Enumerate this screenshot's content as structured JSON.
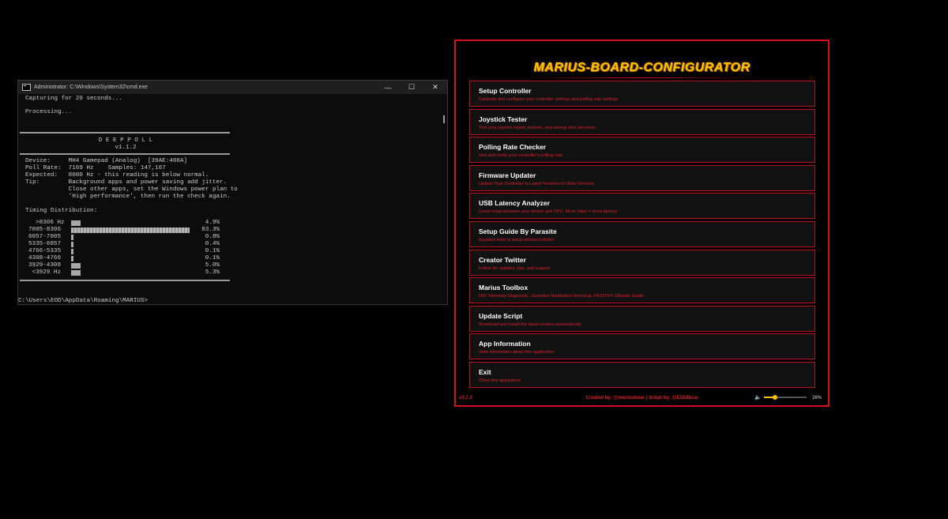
{
  "cmd": {
    "title": "Administrator: C:\\Windows\\System32\\cmd.exe",
    "controls": {
      "minimize": "—",
      "maximize": "☐",
      "close": "✕"
    },
    "capturing": "Capturing for 20 seconds...",
    "processing": "Processing...",
    "banner_title": "D E E P P O L L",
    "banner_version": "v1.1.2",
    "info": [
      "Device:     MH4 Gamepad (Analog)  [39AE:400A]",
      "Poll Rate:  7169 Hz    Samples: 147,167",
      "Expected:   8000 Hz - this reading is below normal.",
      "Tip:        Background apps and power saving add jitter.",
      "            Close other apps, set the Windows power plan to",
      "            'High performance', then run the check again."
    ],
    "timing_heading": "Timing Distribution:",
    "distribution": [
      {
        "range": "  >8306 Hz",
        "percent": "4.9%",
        "value": 4.9
      },
      {
        "range": "7005-8306",
        "percent": "83.3%",
        "value": 83.3
      },
      {
        "range": "6057-7005",
        "percent": "0.8%",
        "value": 0.8
      },
      {
        "range": "5335-6057",
        "percent": "0.4%",
        "value": 0.4
      },
      {
        "range": "4766-5335",
        "percent": "0.1%",
        "value": 0.1
      },
      {
        "range": "4308-4766",
        "percent": "0.1%",
        "value": 0.1
      },
      {
        "range": "3929-4308",
        "percent": "5.0%",
        "value": 5.0
      },
      {
        "range": " <3929 Hz",
        "percent": "5.3%",
        "value": 5.3
      }
    ],
    "prompt": "C:\\Users\\EOD\\AppData\\Roaming\\MARIUS>"
  },
  "configurator": {
    "title": "MARIUS-BOARD-CONFIGURATOR",
    "menu": [
      {
        "label": "Setup Controller",
        "desc": "Calibrate and configure your controller settings and polling rate settings"
      },
      {
        "label": "Joystick Tester",
        "desc": "Test your joystick inputs, buttons, and analog stick precision"
      },
      {
        "label": "Polling Rate Checker",
        "desc": "Test and verify your controller's polling rate"
      },
      {
        "label": "Firmware Updater",
        "desc": "Update Your Controller to Latest Versions Or Beta Versions"
      },
      {
        "label": "USB Latency Analyzer",
        "desc": "Count chips between your device and CPU. More chips = more latency"
      },
      {
        "label": "Setup Guide By Parasite",
        "desc": "Explains How to setup sticks/controller"
      },
      {
        "label": "Creator Twitter",
        "desc": "Follow for updates, tips, and support"
      },
      {
        "label": "Marius Toolbox",
        "desc": "HID Telemetry Diagnostic, Gamebar Notification Removal, FR33THY Ultimate Guide"
      },
      {
        "label": "Update Script",
        "desc": "Download and install the latest version automatically"
      },
      {
        "label": "App Information",
        "desc": "View information about this application"
      },
      {
        "label": "Exit",
        "desc": "Close this application"
      }
    ],
    "version": "v3.7.3",
    "credits": "Created by: @mariusheier  |  Script by: @EODBruu",
    "volume_icon_label": "🔈",
    "volume_icon_name": "speaker-icon",
    "volume_value": 26,
    "volume_pct_label": "26%",
    "colors": {
      "accent": "#d0121b",
      "title": "#ffc400"
    }
  }
}
